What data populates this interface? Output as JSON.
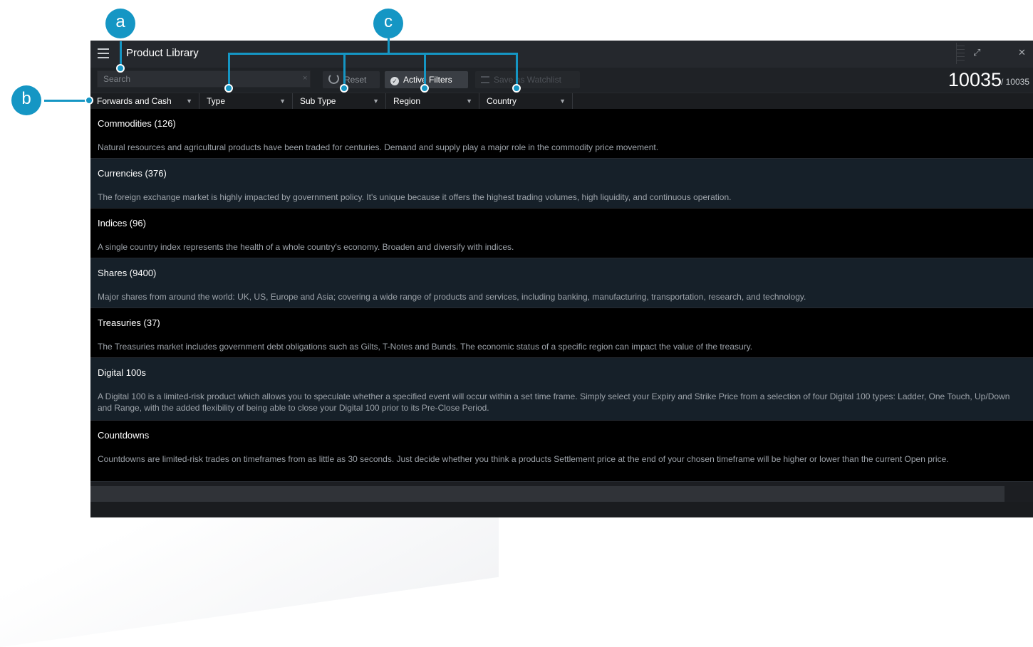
{
  "window": {
    "title": "Product Library"
  },
  "toolbar": {
    "search_placeholder": "Search",
    "search_value": "",
    "clear_icon": "×",
    "reset_label": "Reset",
    "active_filters_label": "Active Filters",
    "save_watchlist_label": "Save as Watchlist",
    "count": "10035",
    "total": "/ 10035"
  },
  "filters": {
    "category": "Forwards and Cash",
    "type": "Type",
    "sub_type": "Sub Type",
    "region": "Region",
    "country": "Country"
  },
  "products": [
    {
      "title": "Commodities (126)",
      "description": "Natural resources and agricultural products have been traded for centuries. Demand and supply play a major role in the commodity price movement."
    },
    {
      "title": "Currencies (376)",
      "description": "The foreign exchange market is highly impacted by government policy. It's unique because it offers the highest trading volumes, high liquidity, and continuous operation."
    },
    {
      "title": "Indices (96)",
      "description": "A single country index represents the health of a whole country's economy. Broaden and diversify with indices."
    },
    {
      "title": "Shares (9400)",
      "description": "Major shares from around the world: UK, US, Europe and Asia; covering a wide range of products and services, including banking, manufacturing, transportation, research, and technology."
    },
    {
      "title": "Treasuries (37)",
      "description": "The Treasuries market includes government debt obligations such as Gilts, T-Notes and Bunds. The economic status of a specific region can impact the value of the treasury."
    },
    {
      "title": "Digital 100s",
      "description": "A Digital 100 is a limited-risk product which allows you to speculate whether a specified event will occur within a set time frame. Simply select your Expiry and Strike Price from a selection of four Digital 100 types: Ladder, One Touch, Up/Down and Range, with the added flexibility of being able to close your Digital 100 prior to its Pre-Close Period."
    },
    {
      "title": "Countdowns",
      "description": "Countdowns are limited-risk trades on timeframes from as little as 30 seconds. Just decide whether you think a products Settlement price at the end of your chosen timeframe will be higher or lower than the current Open price."
    }
  ],
  "callouts": {
    "a": "a",
    "b": "b",
    "c": "c"
  },
  "colors": {
    "accent": "#1596c4",
    "row_dark": "#000000",
    "row_light": "#162029"
  }
}
